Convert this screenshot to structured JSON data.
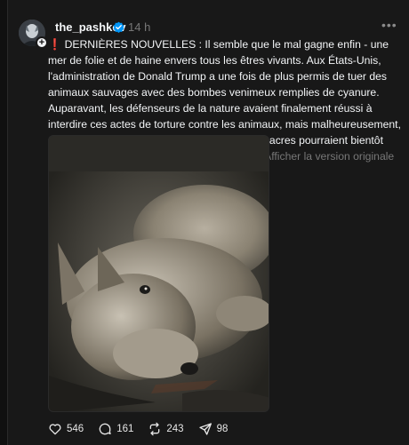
{
  "post": {
    "username": "the_pashkov",
    "time": "14 h",
    "more_label": "•••",
    "alert_icon": "❗",
    "body": "DERNIÈRES NOUVELLES : Il semble que le mal gagne enfin - une mer de folie et de haine envers tous les êtres vivants. Aux États-Unis, l'administration de Donald Trump a une fois de plus permis de tuer des animaux sauvages avec des bombes venimeux remplies de cyanure. Auparavant, les défenseurs de la nature avaient finalement réussi à interdire ces actes de torture contre les animaux, mais malheureusement, cette interdiction vient d'être levée et les massacres pourraient bientôt recommencer à travers les terres fédérales.",
    "translate_link": "Afficher la version originale",
    "image_icon": "wolf-pup-photo"
  },
  "actions": {
    "likes": "546",
    "comments": "161",
    "reposts": "243",
    "shares": "98"
  },
  "colors": {
    "background": "#101010",
    "card": "#181818",
    "text": "#f3f5f7",
    "muted": "#777777",
    "verified": "#0095f6"
  }
}
